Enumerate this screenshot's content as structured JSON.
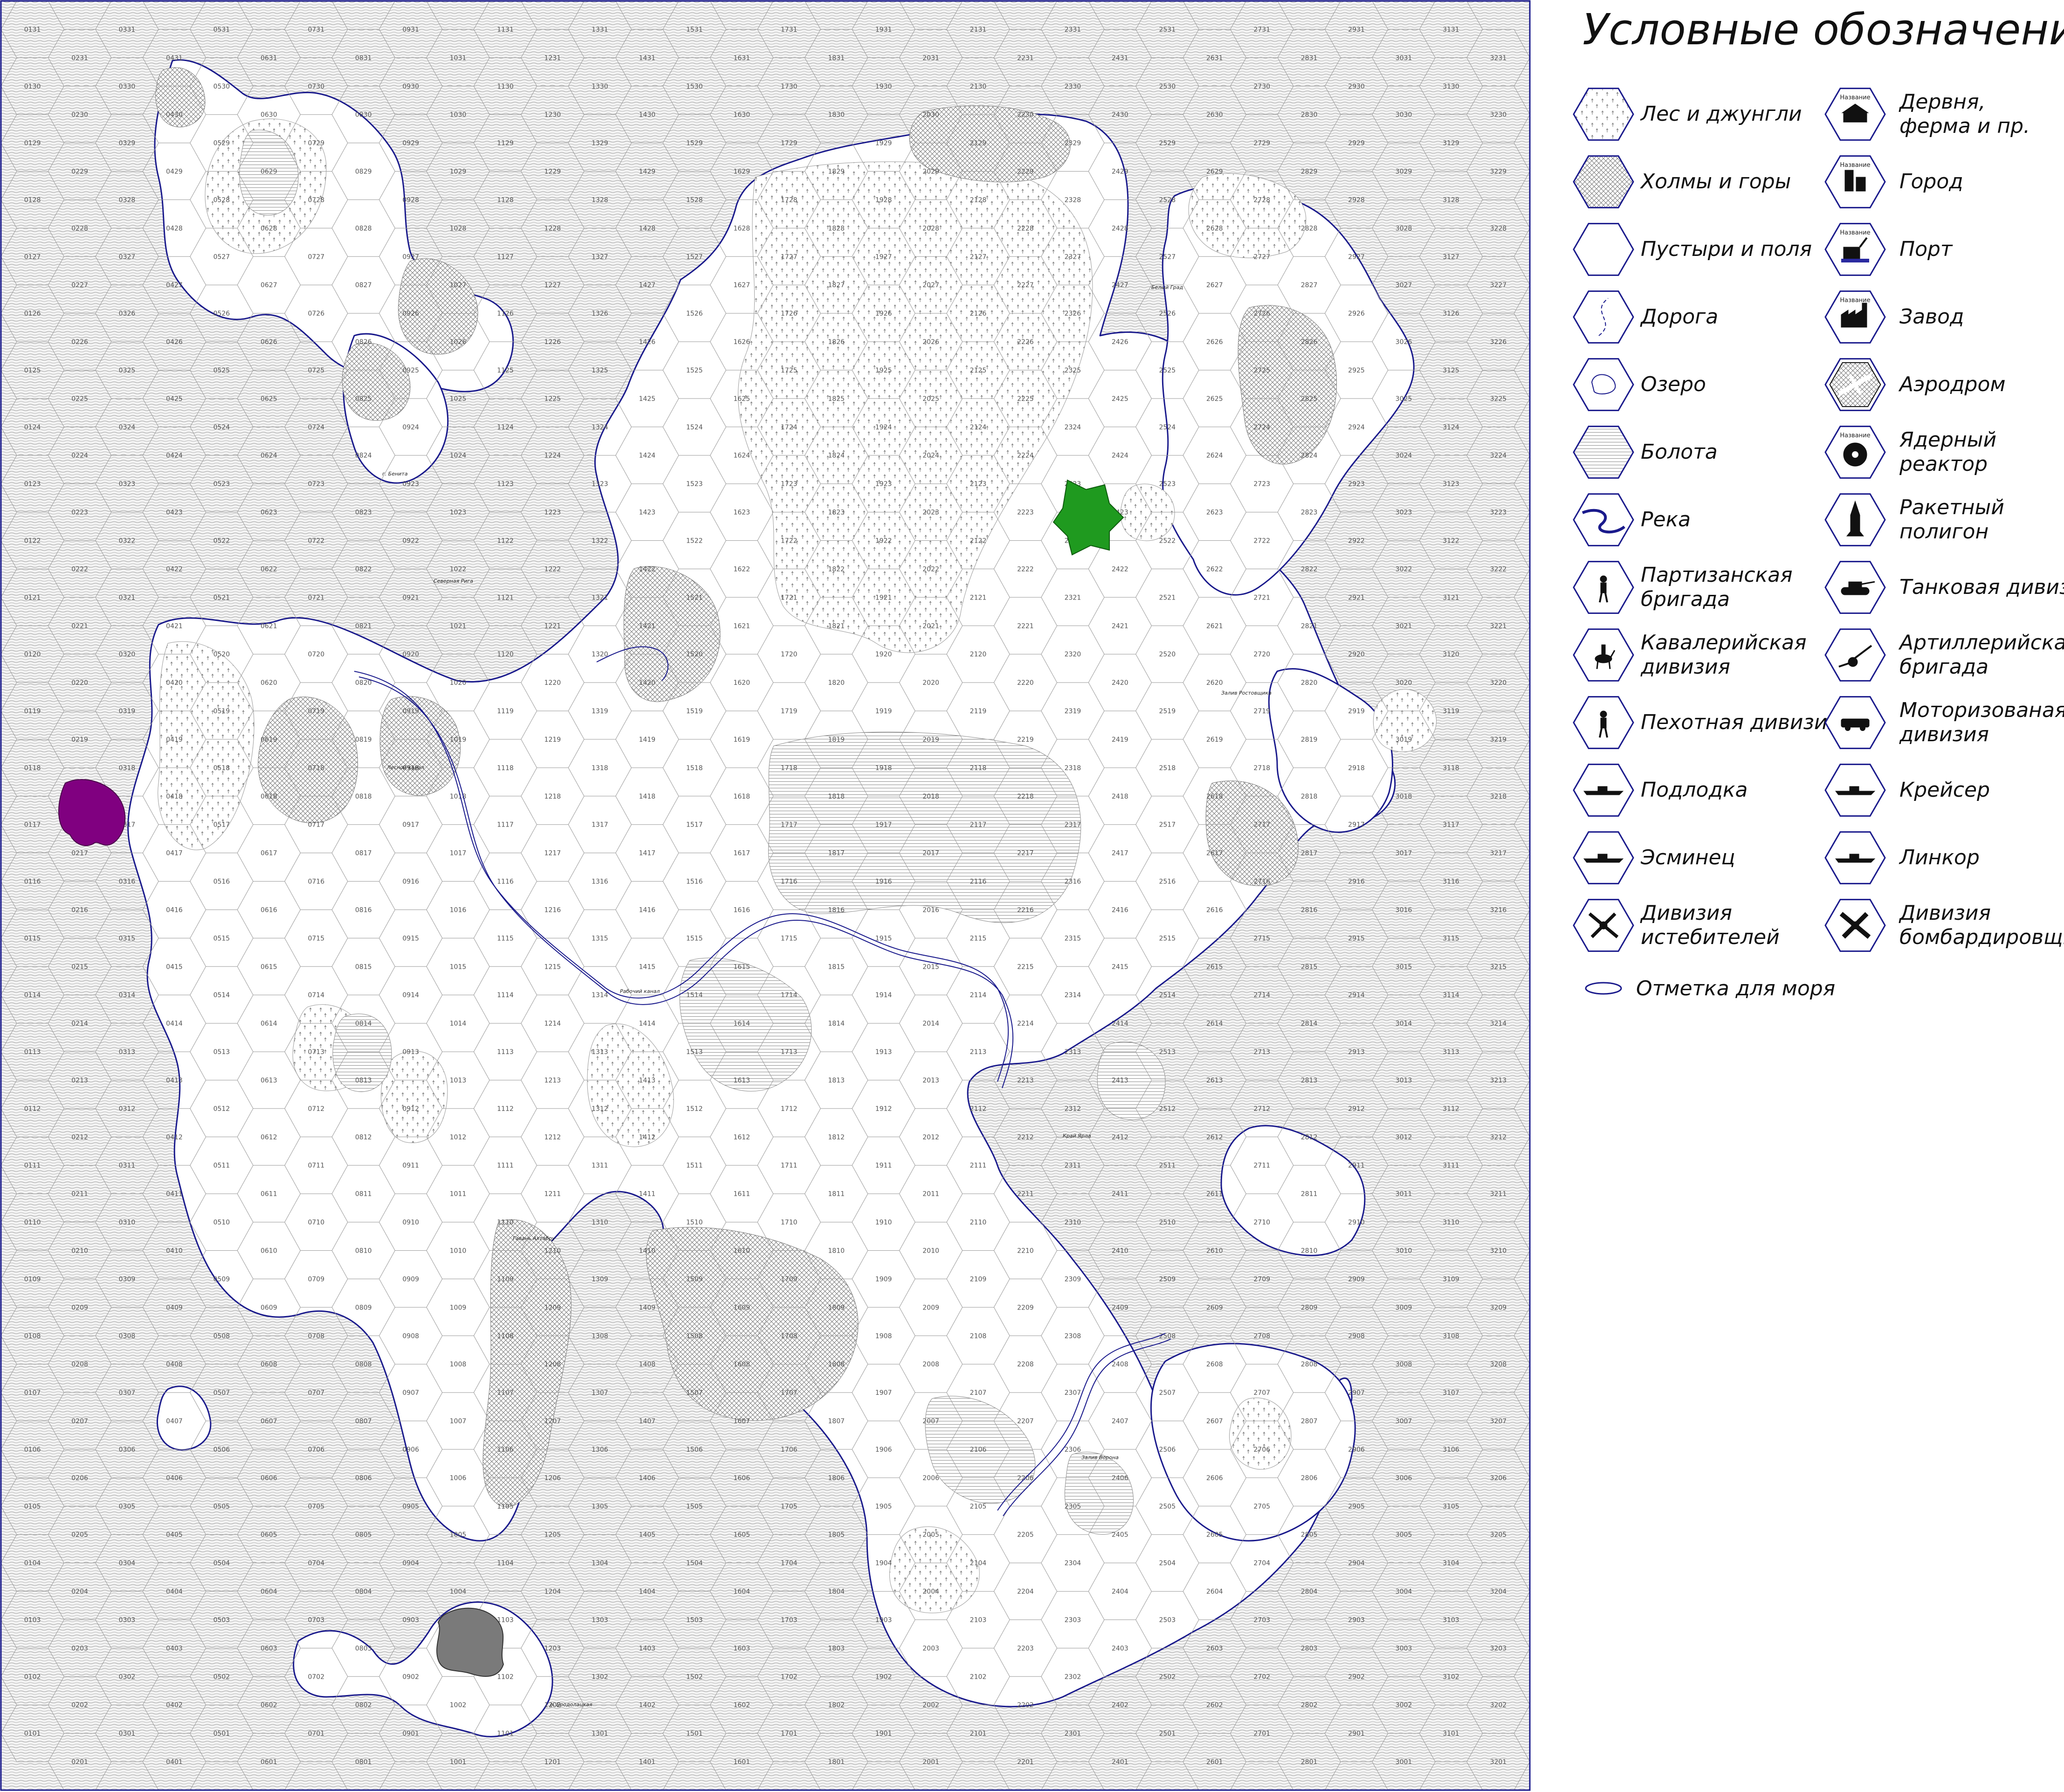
{
  "legend": {
    "title": "Условные обозначения:",
    "left": [
      {
        "id": "forest",
        "label": [
          "Лес и джунгли"
        ],
        "icon": "forest-icon"
      },
      {
        "id": "hills",
        "label": [
          "Холмы и горы"
        ],
        "icon": "hills-icon"
      },
      {
        "id": "plain",
        "label": [
          "Пустыри и поля"
        ],
        "icon": "plain-icon"
      },
      {
        "id": "road",
        "label": [
          "Дорога"
        ],
        "icon": "road-icon"
      },
      {
        "id": "lake",
        "label": [
          "Озеро"
        ],
        "icon": "lake-icon"
      },
      {
        "id": "swamp",
        "label": [
          "Болота"
        ],
        "icon": "swamp-icon"
      },
      {
        "id": "river",
        "label": [
          "Река"
        ],
        "icon": "river-icon"
      },
      {
        "id": "partisan",
        "label": [
          "Партизанская",
          "бригада"
        ],
        "icon": "partisan-icon"
      },
      {
        "id": "cavalry",
        "label": [
          "Кавалерийская",
          "дивизия"
        ],
        "icon": "cavalry-icon"
      },
      {
        "id": "infantry",
        "label": [
          "Пехотная дивизия"
        ],
        "icon": "infantry-icon"
      },
      {
        "id": "submarine",
        "label": [
          "Подлодка"
        ],
        "icon": "submarine-icon"
      },
      {
        "id": "destroyer",
        "label": [
          "Эсминец"
        ],
        "icon": "destroyer-icon"
      },
      {
        "id": "fighter",
        "label": [
          "Дивизия",
          "истебителей"
        ],
        "icon": "fighter-icon"
      }
    ],
    "right": [
      {
        "id": "village",
        "label": [
          "Дервня,",
          "ферма и пр."
        ],
        "icon": "village-icon",
        "tag": "Название"
      },
      {
        "id": "city",
        "label": [
          "Город"
        ],
        "icon": "city-icon",
        "tag": "Название"
      },
      {
        "id": "port",
        "label": [
          "Порт"
        ],
        "icon": "port-icon",
        "tag": "Название"
      },
      {
        "id": "factory",
        "label": [
          "Завод"
        ],
        "icon": "factory-icon",
        "tag": "Название"
      },
      {
        "id": "airfield",
        "label": [
          "Аэродром"
        ],
        "icon": "airfield-icon"
      },
      {
        "id": "reactor",
        "label": [
          "Ядерный",
          "реактор"
        ],
        "icon": "reactor-icon",
        "tag": "Название"
      },
      {
        "id": "missile",
        "label": [
          "Ракетный",
          "полигон"
        ],
        "icon": "missile-icon"
      },
      {
        "id": "tank",
        "label": [
          "Танковая дивизия"
        ],
        "icon": "tank-icon"
      },
      {
        "id": "artillery",
        "label": [
          "Артиллерийская",
          "бригада"
        ],
        "icon": "artillery-icon"
      },
      {
        "id": "motorized",
        "label": [
          "Моторизованая",
          "дивизия"
        ],
        "icon": "motorized-icon"
      },
      {
        "id": "cruiser",
        "label": [
          "Крейсер"
        ],
        "icon": "cruiser-icon"
      },
      {
        "id": "battleship",
        "label": [
          "Линкор"
        ],
        "icon": "battleship-icon"
      },
      {
        "id": "bomber",
        "label": [
          "Дивизия",
          "бомбардировщиков"
        ],
        "icon": "bomber-icon"
      }
    ],
    "sea_mark": {
      "label": "Отметка для моря",
      "icon": "sea-mark-icon"
    }
  },
  "map": {
    "grid_cols": 32,
    "grid_rows": 31,
    "colors": {
      "sea_lines": "#8a8a8a",
      "coast": "#1a1a8c",
      "hex_line": "#9a9a9a",
      "forest_mark": "#666666",
      "hills_hatch": "#7a7a7a",
      "swamp_lines": "#8c8c8c",
      "green_marker": "#1f9a1f",
      "purple_marker": "#800080",
      "grey_marker": "#7a7a7a"
    },
    "place_labels": [
      "г. Бенита",
      "Северная Рига",
      "Лесной канал",
      "Рабочий канал",
      "Гавань Ахтабру",
      "Белый Град",
      "Залив Ростовщика",
      "Залив Ворона",
      "Край Ярла",
      "о. Бродолацкая"
    ]
  }
}
